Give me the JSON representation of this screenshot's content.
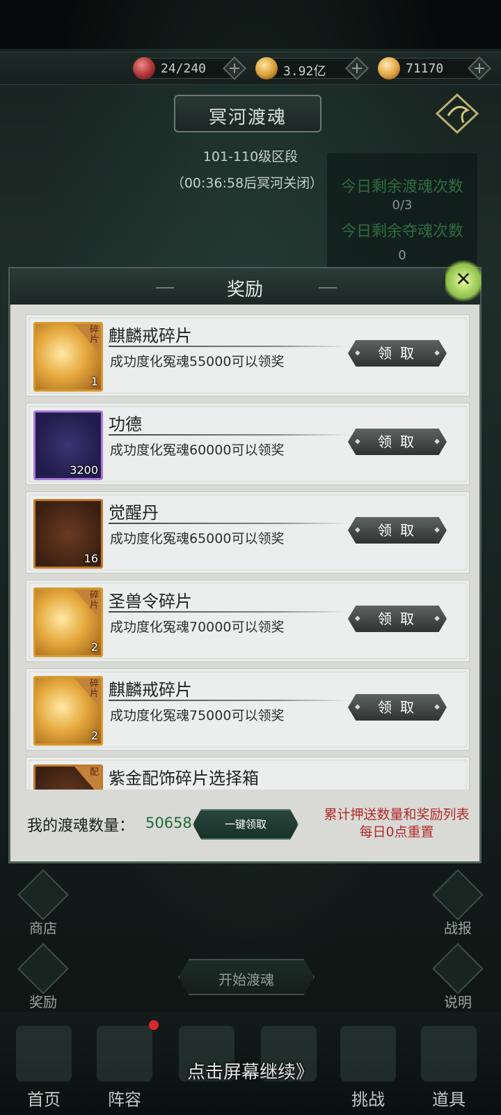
{
  "resources": [
    {
      "value": "24/240",
      "icon": "red-orb-icon"
    },
    {
      "value": "3.92亿",
      "icon": "coin-bag-icon"
    },
    {
      "value": "71170",
      "icon": "heart-gem-icon"
    }
  ],
  "header": {
    "title": "冥河渡魂",
    "tier": "101-110级区段",
    "countdown": "（00:36:58后冥河关闭）"
  },
  "remaining": {
    "ferry_label": "今日剩余渡魂次数",
    "ferry_value": "0/3",
    "steal_label": "今日剩余夺魂次数",
    "steal_value": "0"
  },
  "modal": {
    "title": "奖励",
    "claim_label": "领取",
    "items": [
      {
        "name": "麒麟戒碎片",
        "desc": "成功度化冤魂55000可以领奖",
        "count": "1",
        "frag": "碎片",
        "style": "gold"
      },
      {
        "name": "功德",
        "desc": "成功度化冤魂60000可以领奖",
        "count": "3200",
        "frag": "",
        "style": "purple"
      },
      {
        "name": "觉醒丹",
        "desc": "成功度化冤魂65000可以领奖",
        "count": "16",
        "frag": "",
        "style": "brown"
      },
      {
        "name": "圣兽令碎片",
        "desc": "成功度化冤魂70000可以领奖",
        "count": "2",
        "frag": "碎片",
        "style": "gold"
      },
      {
        "name": "麒麟戒碎片",
        "desc": "成功度化冤魂75000可以领奖",
        "count": "2",
        "frag": "碎片",
        "style": "gold"
      },
      {
        "name": "紫金配饰碎片选择箱",
        "desc": "",
        "count": "",
        "frag": "配",
        "style": "brown"
      }
    ],
    "my_count_label": "我的渡魂数量：",
    "my_count_value": "50658",
    "claim_all_label": "一键领取",
    "reset_note": "累计押送数量和奖励列表每日0点重置"
  },
  "side": {
    "shop": "商店",
    "reward": "奖励",
    "battle_report": "战报",
    "help": "说明",
    "start": "开始渡魂"
  },
  "nav": [
    "首页",
    "阵容",
    "",
    "",
    "挑战",
    "道具"
  ],
  "continue_hint": "点击屏幕继续》"
}
